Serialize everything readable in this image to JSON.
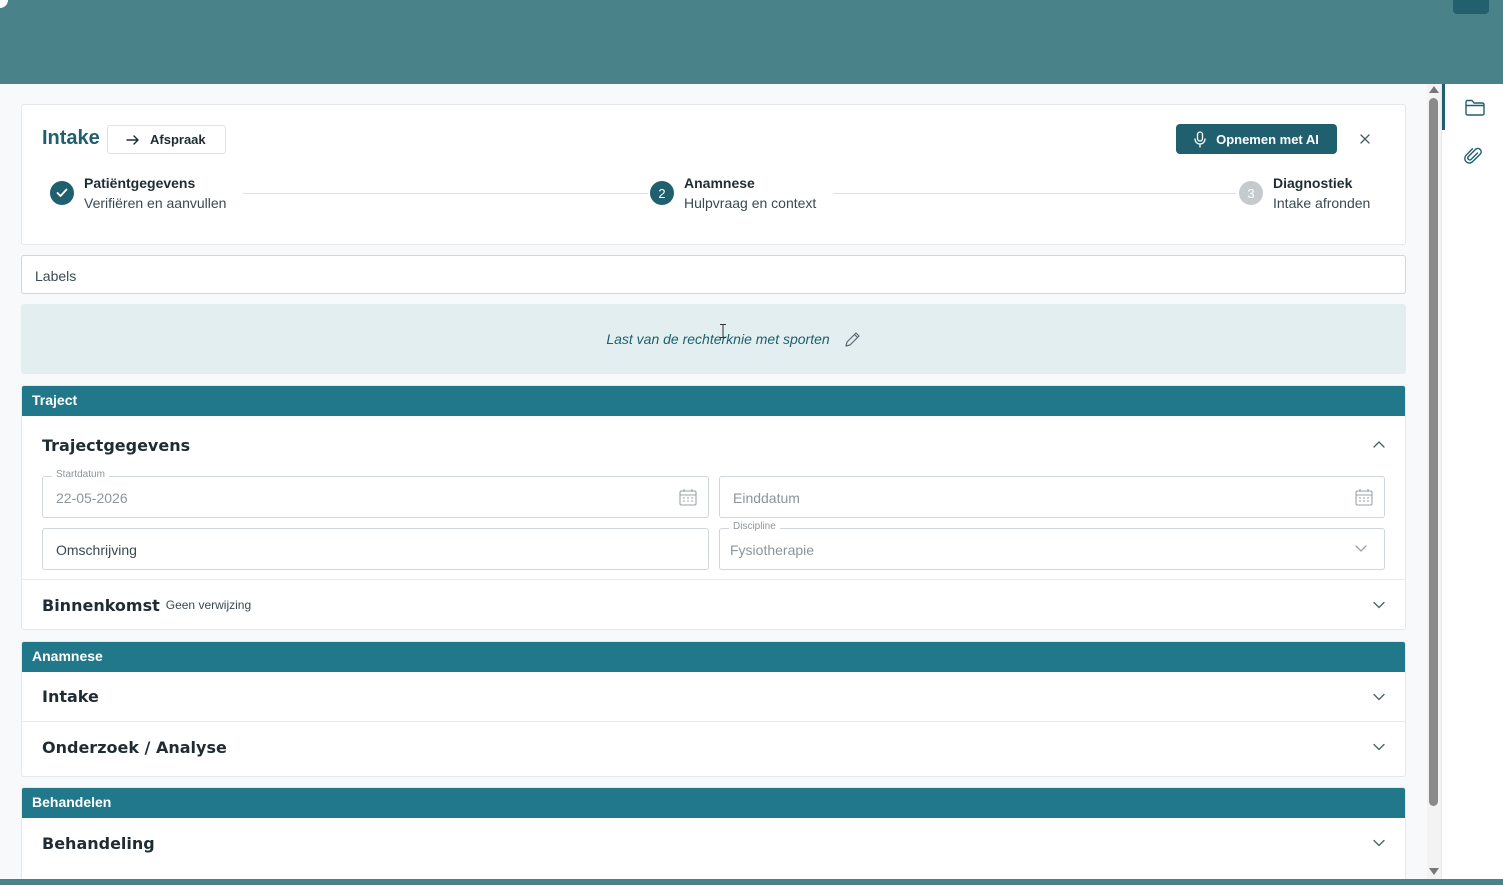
{
  "header": {
    "title": "Intake",
    "afspraak_label": "Afspraak",
    "ai_button_label": "Opnemen met AI"
  },
  "steps": [
    {
      "index": "",
      "title": "Patiëntgegevens",
      "subtitle": "Verifiëren en aanvullen",
      "state": "done"
    },
    {
      "index": "2",
      "title": "Anamnese",
      "subtitle": "Hulpvraag en context",
      "state": "active"
    },
    {
      "index": "3",
      "title": "Diagnostiek",
      "subtitle": "Intake afronden",
      "state": "pending"
    }
  ],
  "labels_field": {
    "placeholder": "Labels"
  },
  "complaint": {
    "text": "Last van de rechterknie met sporten"
  },
  "traject": {
    "heading": "Traject",
    "trajectgegevens": {
      "title": "Trajectgegevens",
      "startdatum": {
        "label": "Startdatum",
        "value": "22-05-2026"
      },
      "einddatum": {
        "placeholder": "Einddatum"
      },
      "omschrijving": {
        "placeholder": "Omschrijving"
      },
      "discipline": {
        "label": "Discipline",
        "value": "Fysiotherapie"
      }
    },
    "binnenkomst": {
      "title": "Binnenkomst",
      "subtitle": "Geen verwijzing"
    }
  },
  "anamnese": {
    "heading": "Anamnese",
    "items": [
      "Intake",
      "Onderzoek / Analyse"
    ]
  },
  "behandelen": {
    "heading": "Behandelen",
    "items": [
      "Behandeling"
    ]
  },
  "colors": {
    "primary": "#1f5f6e",
    "section_header": "#22788b",
    "topbar": "#4a8289",
    "complaint_bg": "#e2eeef",
    "step_pending": "#c5cbcd"
  },
  "icons": {
    "afspraak": "arrow-right-icon",
    "ai_button": "microphone-icon",
    "close": "close-icon",
    "step_done": "check-icon",
    "complaint_edit": "pencil-icon",
    "date": "calendar-icon",
    "rail": [
      "folder-icon",
      "paperclip-icon"
    ]
  }
}
